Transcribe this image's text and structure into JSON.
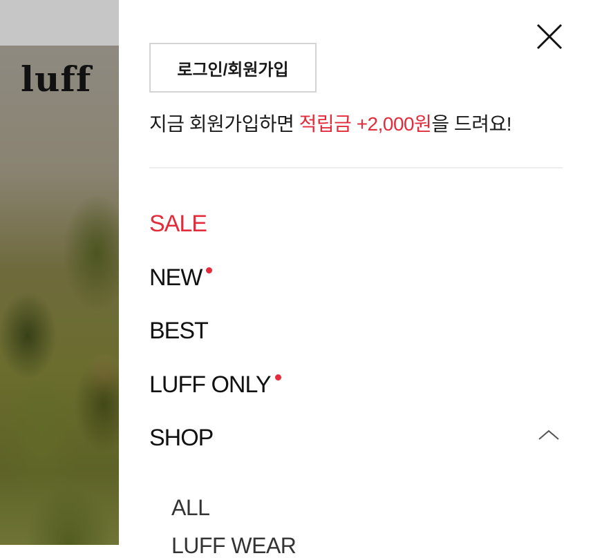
{
  "background_page": {
    "logo_text": "luff"
  },
  "drawer": {
    "login_button_label": "로그인/회원가입",
    "promo": {
      "prefix": "지금 회원가입하면 ",
      "highlight": "적립금 +2,000원",
      "suffix": "을 드려요!",
      "highlight_color": "#e22b3b"
    },
    "menu": [
      {
        "label": "SALE",
        "highlight": true,
        "new_dot": false
      },
      {
        "label": "NEW",
        "highlight": false,
        "new_dot": true
      },
      {
        "label": "BEST",
        "highlight": false,
        "new_dot": false
      },
      {
        "label": "LUFF ONLY",
        "highlight": false,
        "new_dot": true
      },
      {
        "label": "SHOP",
        "highlight": false,
        "new_dot": false,
        "expanded": true
      }
    ],
    "shop_submenu": [
      {
        "label": "ALL"
      },
      {
        "label": "LUFF WEAR"
      }
    ],
    "icons": {
      "close": "close-icon",
      "collapse": "chevron-up-icon",
      "new_indicator": "red-dot"
    }
  }
}
